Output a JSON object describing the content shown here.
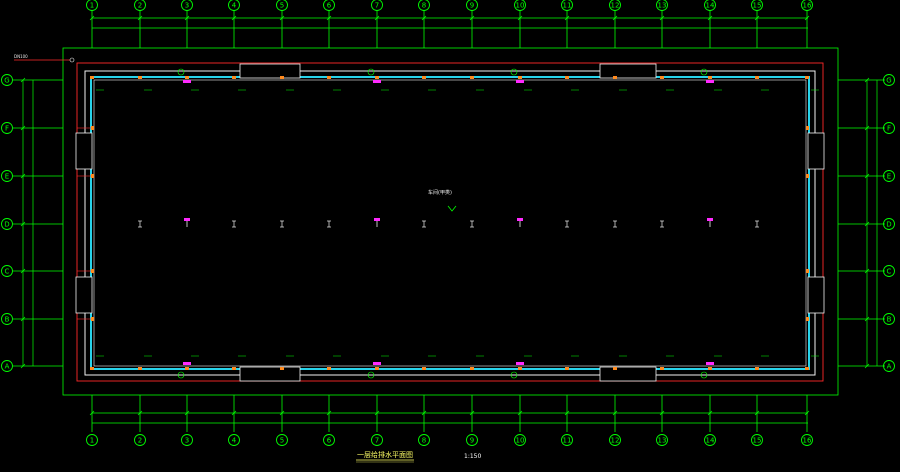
{
  "drawing": {
    "title": "一层给排水平面图",
    "scale": "1:150",
    "room_label": "车间(甲类)",
    "pipe_note": "DN100"
  },
  "axes_x": [
    "1",
    "2",
    "3",
    "4",
    "5",
    "6",
    "7",
    "8",
    "9",
    "10",
    "11",
    "12",
    "13",
    "14",
    "15",
    "16"
  ],
  "axes_y": [
    "G",
    "F",
    "E",
    "D",
    "C",
    "B",
    "A"
  ],
  "colors": {
    "background": "#000000",
    "grid": "#00ff00",
    "pipe_red": "#ff2a2a",
    "wall_cyan": "#27d3ea",
    "wall_white": "#f2f2f2",
    "fixture_magenta": "#ff2aff",
    "fixture_orange": "#ff8a1e",
    "title_yellow": "#ffff66"
  }
}
